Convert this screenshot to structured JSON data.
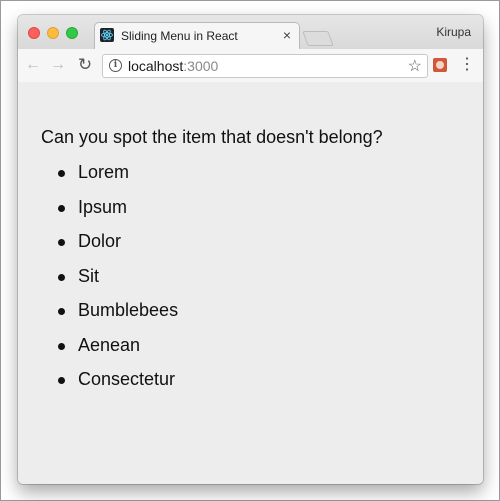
{
  "browser": {
    "tab": {
      "title": "Sliding Menu in React",
      "favicon": "react-logo-icon",
      "close_glyph": "×"
    },
    "profile_name": "Kirupa",
    "toolbar": {
      "back": "←",
      "forward": "→",
      "reload": "↻",
      "info": "i",
      "url_host": "localhost",
      "url_port": ":3000",
      "star": "☆",
      "menu": "⋮"
    }
  },
  "page": {
    "question": "Can you spot the item that doesn't belong?",
    "items": [
      "Lorem",
      "Ipsum",
      "Dolor",
      "Sit",
      "Bumblebees",
      "Aenean",
      "Consectetur"
    ]
  },
  "colors": {
    "close": "#fc605c",
    "minimize": "#fdbc40",
    "maximize": "#34c84a",
    "page_background": "#ededed"
  }
}
